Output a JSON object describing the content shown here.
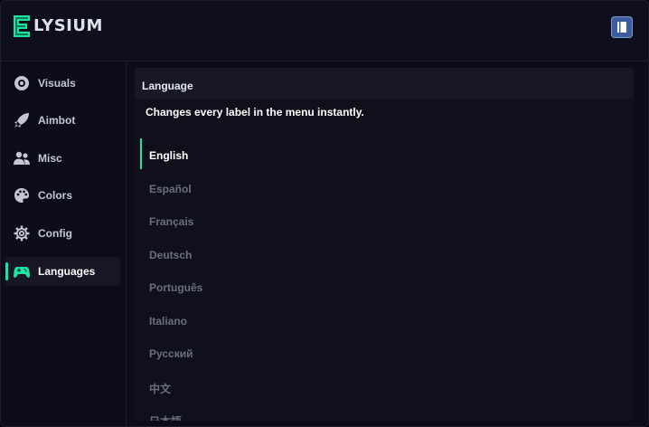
{
  "app": {
    "title": "ELYSIUM",
    "logo_letters": "LYSIUM",
    "accent_color": "#19e6a3"
  },
  "header": {
    "right_button_icon": "book-icon"
  },
  "sidebar": {
    "items": [
      {
        "label": "Visuals",
        "icon": "eye-icon",
        "active": false
      },
      {
        "label": "Aimbot",
        "icon": "rocket-icon",
        "active": false
      },
      {
        "label": "Misc",
        "icon": "users-icon",
        "active": false
      },
      {
        "label": "Colors",
        "icon": "palette-icon",
        "active": false
      },
      {
        "label": "Config",
        "icon": "gear-icon",
        "active": false
      },
      {
        "label": "Languages",
        "icon": "gamepad-icon",
        "active": true
      }
    ]
  },
  "panel": {
    "title": "Language",
    "description": "Changes every label in the menu instantly.",
    "selected": "English",
    "languages": [
      "English",
      "Español",
      "Français",
      "Deutsch",
      "Português",
      "Italiano",
      "Русский",
      "中文",
      "日本語"
    ]
  }
}
